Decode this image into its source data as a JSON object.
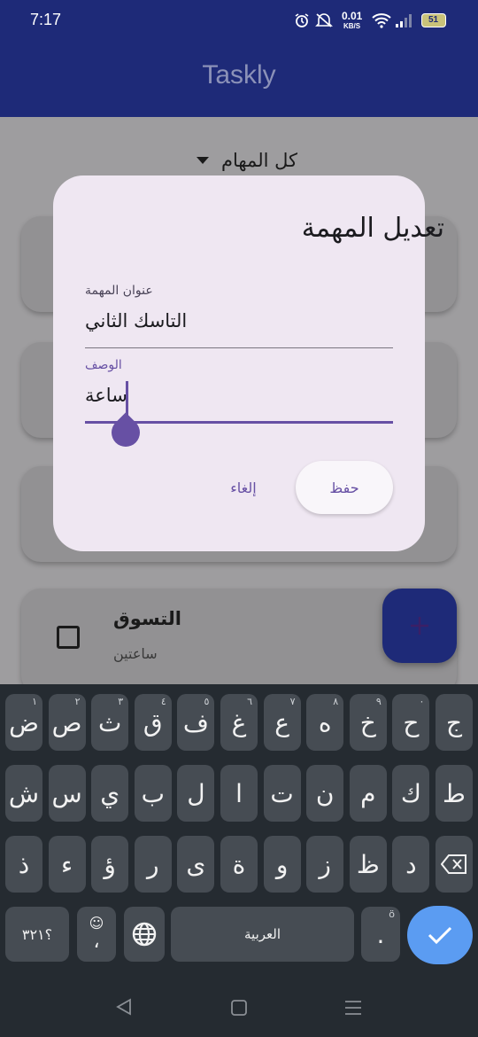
{
  "status_bar": {
    "time": "7:17",
    "net_speed": "0.01",
    "net_unit": "KB/S",
    "battery": "51"
  },
  "app": {
    "title": "Taskly"
  },
  "filter": {
    "label": "كل المهام"
  },
  "task": {
    "title": "التسوق",
    "subtitle": "ساعتين"
  },
  "dialog": {
    "title": "تعديل المهمة",
    "title_label": "عنوان المهمة",
    "title_value": "التاسك الثاني",
    "desc_label": "الوصف",
    "desc_value": "ساعة",
    "cancel_label": "إلغاء",
    "save_label": "حفظ"
  },
  "keyboard": {
    "row1": [
      {
        "c": "ض",
        "h": "١"
      },
      {
        "c": "ص",
        "h": "٢"
      },
      {
        "c": "ث",
        "h": "٣"
      },
      {
        "c": "ق",
        "h": "٤"
      },
      {
        "c": "ف",
        "h": "٥"
      },
      {
        "c": "غ",
        "h": "٦"
      },
      {
        "c": "ع",
        "h": "٧"
      },
      {
        "c": "ه",
        "h": "٨"
      },
      {
        "c": "خ",
        "h": "٩"
      },
      {
        "c": "ح",
        "h": "٠"
      },
      {
        "c": "ج",
        "h": ""
      }
    ],
    "row2": [
      "ش",
      "س",
      "ي",
      "ب",
      "ل",
      "ا",
      "ت",
      "ن",
      "م",
      "ك",
      "ط"
    ],
    "row3": [
      "ذ",
      "ء",
      "ؤ",
      "ر",
      "ى",
      "ة",
      "و",
      "ز",
      "ظ",
      "د"
    ],
    "symbols_key": "؟٣٢١",
    "emoji_hint": "☺",
    "comma": "،",
    "space_label": "العربية",
    "period": ".",
    "period_hint": "ö"
  },
  "colors": {
    "appbar": "#1e2a78",
    "accent": "#6750a4",
    "dialog": "#efe7f2",
    "keyboard": "#252b31",
    "enter_key": "#5b9cf2"
  }
}
